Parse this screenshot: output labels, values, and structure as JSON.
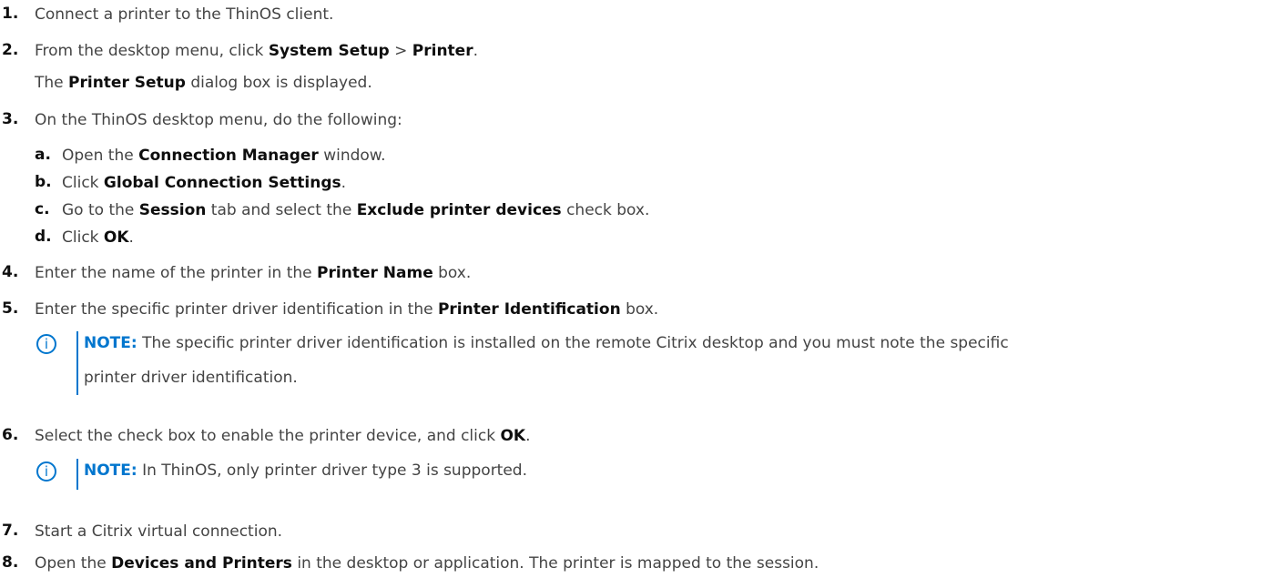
{
  "steps": [
    {
      "num": "1.",
      "parts": [
        "Connect a printer to the ThinOS client."
      ]
    },
    {
      "num": "2.",
      "parts": [
        "From the desktop menu, click ",
        "System Setup",
        " > ",
        "Printer",
        "."
      ]
    },
    {
      "sub_text": [
        "The ",
        "Printer Setup",
        " dialog box is displayed."
      ]
    },
    {
      "num": "3.",
      "parts": [
        "On the ThinOS desktop menu, do the following:"
      ]
    },
    {
      "num": "a.",
      "parts": [
        "Open the ",
        "Connection Manager",
        " window."
      ]
    },
    {
      "num": "b.",
      "parts": [
        "Click ",
        "Global Connection Settings",
        "."
      ]
    },
    {
      "num": "c.",
      "parts": [
        "Go to the ",
        "Session",
        " tab and select the ",
        "Exclude printer devices",
        " check box."
      ]
    },
    {
      "num": "d.",
      "parts": [
        "Click ",
        "OK",
        "."
      ]
    },
    {
      "num": "4.",
      "parts": [
        "Enter the name of the printer in the ",
        "Printer Name",
        " box."
      ]
    },
    {
      "num": "5.",
      "parts": [
        "Enter the specific printer driver identification in the ",
        "Printer Identification",
        " box."
      ]
    },
    {
      "num": "6.",
      "parts": [
        "Select the check box to enable the printer device, and click ",
        "OK",
        "."
      ]
    },
    {
      "num": "7.",
      "parts": [
        "Start a Citrix virtual connection."
      ]
    },
    {
      "num": "8.",
      "parts": [
        "Open the ",
        "Devices and Printers",
        " in the desktop or application. The printer is mapped to the session."
      ]
    }
  ],
  "notes": [
    {
      "label": "NOTE:",
      "line1": " The specific printer driver identification is installed on the remote Citrix desktop and you must note the specific",
      "line2": "printer driver identification."
    },
    {
      "label": "NOTE:",
      "line1": " In ThinOS, only printer driver type 3 is supported."
    }
  ],
  "note_icon_glyph": "i",
  "colors": {
    "text": "#444444",
    "bold": "#0e0e0e",
    "note_accent": "#0076ce"
  }
}
